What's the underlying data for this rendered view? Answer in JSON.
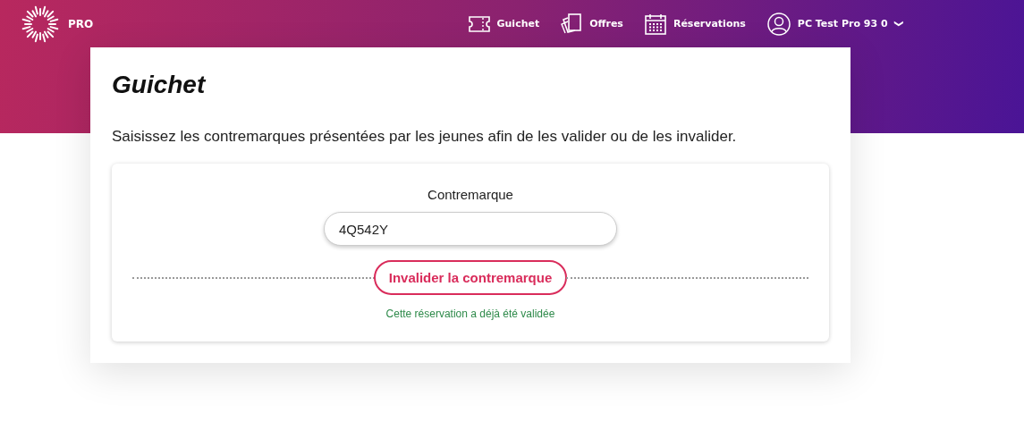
{
  "header": {
    "logo_text": "PRO",
    "nav": [
      {
        "kind": "ticket",
        "label": "Guichet"
      },
      {
        "kind": "offers",
        "label": "Offres"
      },
      {
        "kind": "calendar",
        "label": "Réservations"
      }
    ],
    "user": {
      "name": "PC Test Pro 93 0",
      "caret": "❯"
    }
  },
  "page": {
    "title": "Guichet",
    "intro": "Saisissez les contremarques présentées par les jeunes afin de les valider ou de les invalider."
  },
  "form": {
    "label": "Contremarque",
    "value": "4Q542Y",
    "button": "Invalider la contremarque",
    "message": "Cette réservation a déjà été validée"
  }
}
